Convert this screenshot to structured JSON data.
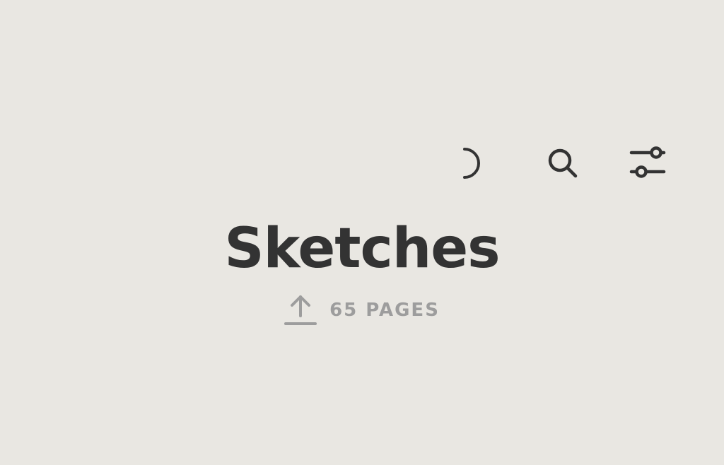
{
  "toolbar": {
    "icons": [
      "loading-spinner-icon",
      "search-icon",
      "sliders-icon"
    ]
  },
  "collection": {
    "title": "Sketches",
    "page_count": "65 PAGES",
    "icon": "upload-arrow-icon"
  },
  "colors": {
    "background": "#e9e7e2",
    "title": "#333333",
    "icon": "#333333",
    "meta": "#9d9d9d"
  }
}
